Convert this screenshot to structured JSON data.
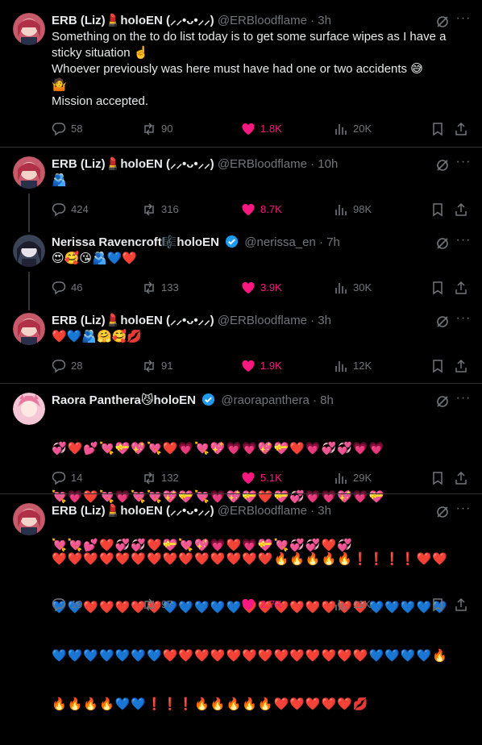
{
  "colors": {
    "background": "#000000",
    "text": "#e7e9ea",
    "muted": "#71767b",
    "like": "#f91880",
    "divider": "#2f3336",
    "verified": "#1d9bf0"
  },
  "tweets": [
    {
      "name": "ERB (Liz)💄holoEN (⸝⸝•ᴗ•⸝⸝)",
      "handle": "@ERBloodflame",
      "time": "3h",
      "text": "Something on the to do list today is to get some surface wipes as I have a sticky situation ☝️\nWhoever previously was here must have had one or two accidents 😅\n🤷\nMission accepted.",
      "replies": "58",
      "reposts": "90",
      "likes": "1.8K",
      "views": "20K"
    },
    {
      "name": "ERB (Liz)💄holoEN (⸝⸝•ᴗ•⸝⸝)",
      "handle": "@ERBloodflame",
      "time": "10h",
      "text": "🫂",
      "replies": "424",
      "reposts": "316",
      "likes": "8.7K",
      "views": "98K"
    },
    {
      "name": "Nerissa Ravencroft🎼holoEN",
      "handle": "@nerissa_en",
      "time": "7h",
      "text": "😍🥰😘🫂💙❤️",
      "replies": "46",
      "reposts": "133",
      "likes": "3.9K",
      "views": "30K"
    },
    {
      "name": "ERB (Liz)💄holoEN (⸝⸝•ᴗ•⸝⸝)",
      "handle": "@ERBloodflame",
      "time": "3h",
      "text": "❤️💙🫂🤗🥰💋",
      "replies": "28",
      "reposts": "91",
      "likes": "1.9K",
      "views": "12K"
    },
    {
      "name": "Raora Panthera😼holoEN",
      "handle": "@raorapanthera",
      "time": "8h",
      "rows": [
        "💞❤️💕💘💝💖💘❤️💗💘💖💗💗💖💝❤️💗💞💞💗💗",
        "💘💗❤️💘💗💘💘💖💝💘💗💖💝❤️💝💞💗💗💖💗💝",
        "💘💘💕❤️💞💞❤️💝💘💖💗❤️💗💝💘💞💞❤️💞"
      ],
      "replies": "14",
      "reposts": "132",
      "likes": "5.1K",
      "views": "29K"
    },
    {
      "name": "ERB (Liz)💄holoEN (⸝⸝•ᴗ•⸝⸝)",
      "handle": "@ERBloodflame",
      "time": "3h",
      "rows": [
        "❤️❤️❤️❤️❤️❤️❤️❤️❤️❤️❤️❤️❤️❤️🔥🔥🔥🔥🔥❗❗❗❗❤️❤️",
        "💙💙❤️❤️❤️❤️❤️💙💙💙💙💙❤️❤️❤️❤️❤️❤️❤️❤️💙💙💙💙💙",
        "💙💙💙💙💙💙💙❤️❤️❤️❤️❤️❤️❤️❤️❤️❤️❤️❤️❤️💙💙💙💙🔥",
        "🔥🔥🔥🔥💙💙❗❗❗🔥🔥🔥🔥🔥❤️❤️❤️❤️❤️💋"
      ],
      "replies": "19",
      "reposts": "97",
      "likes": "2.7K",
      "views": "11K"
    }
  ]
}
